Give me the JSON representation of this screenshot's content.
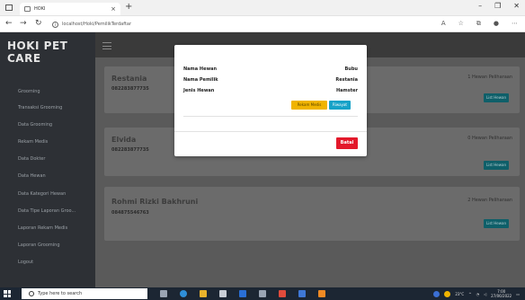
{
  "browser": {
    "tab_title": "HOKI",
    "url": "localhost/Hoki/PemilikTerdaftar"
  },
  "app": {
    "brand": "HOKI PET CARE",
    "sidebar": [
      "Grooming",
      "Transaksi Grooming",
      "Data Grooming",
      "Rekam Medis",
      "Data Dokter",
      "Data Hewan",
      "Data Kategori Hewan",
      "Data Tipe Laporan Groo...",
      "Laporan Rekam Medis",
      "Laporan Grooming",
      "Logout"
    ],
    "cards": [
      {
        "name": "Restania",
        "phone": "082283877735",
        "count": "1 Hewan Peliharaan",
        "button": "List Hewan"
      },
      {
        "name": "Elvida",
        "phone": "082283877735",
        "count": "0 Hewan Peliharaan",
        "button": "List Hewan"
      },
      {
        "name": "Rohmi Rizki Bakhruni",
        "phone": "084875546763",
        "count": "2 Hewan Peliharaan",
        "button": "List Hewan"
      }
    ]
  },
  "modal": {
    "fields": [
      {
        "label": "Nama Hewan",
        "value": "Bubu"
      },
      {
        "label": "Nama Pemilik",
        "value": "Restania"
      },
      {
        "label": "Jenis Hewan",
        "value": "Hamster"
      }
    ],
    "btn_rekam": "Rekam Medis",
    "btn_riwayat": "Riwayat",
    "btn_batal": "Batal"
  },
  "taskbar": {
    "search_placeholder": "Type here to search",
    "weather": "23°C",
    "time": "7:00",
    "date": "27/06/2022"
  },
  "colors": {
    "sidebar": "#2d3035",
    "list_button": "#0f5f69",
    "rekam_button": "#f0b400",
    "riwayat_button": "#17a2c8",
    "batal_button": "#e3192b"
  }
}
